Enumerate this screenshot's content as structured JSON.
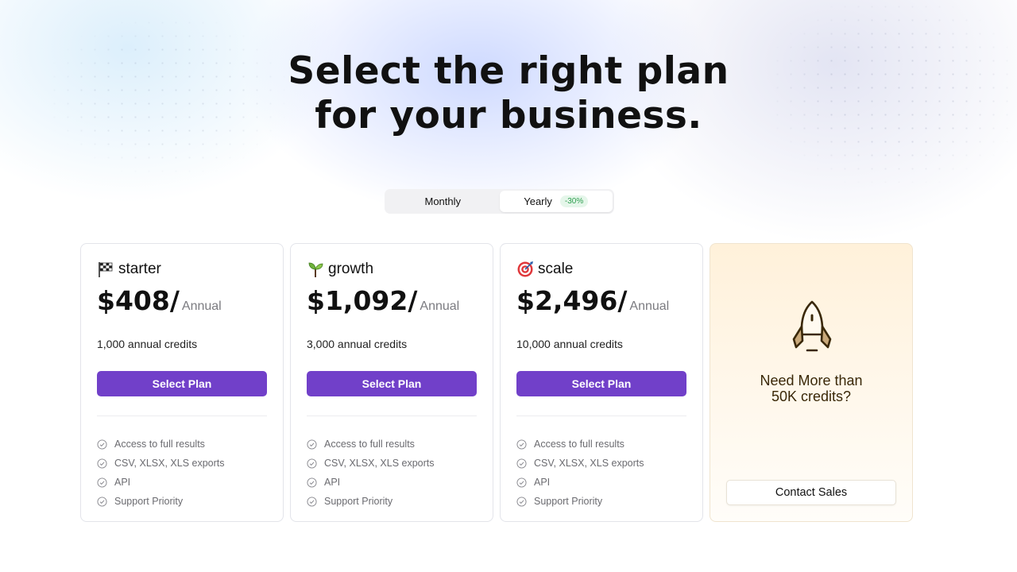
{
  "headline": {
    "line1": "Select the right plan",
    "line2": "for your business."
  },
  "billing_toggle": {
    "monthly_label": "Monthly",
    "yearly_label": "Yearly",
    "yearly_discount": "-30%",
    "selected": "Yearly"
  },
  "plans": [
    {
      "icon": "checkered-flag-icon",
      "name": "starter",
      "price": "$408/",
      "period": "Annual",
      "credits": "1,000 annual credits",
      "button_label": "Select Plan",
      "features": [
        "Access to full results",
        "CSV, XLSX, XLS exports",
        "API",
        "Support Priority"
      ]
    },
    {
      "icon": "seedling-icon",
      "name": "growth",
      "price": "$1,092/",
      "period": "Annual",
      "credits": "3,000 annual credits",
      "button_label": "Select Plan",
      "features": [
        "Access to full results",
        "CSV, XLSX, XLS exports",
        "API",
        "Support Priority"
      ]
    },
    {
      "icon": "target-icon",
      "name": "scale",
      "price": "$2,496/",
      "period": "Annual",
      "credits": "10,000 annual credits",
      "button_label": "Select Plan",
      "features": [
        "Access to full results",
        "CSV, XLSX, XLS exports",
        "API",
        "Support Priority"
      ]
    }
  ],
  "enterprise": {
    "icon": "rocket-icon",
    "line1": "Need More than",
    "line2": "50K credits?",
    "button_label": "Contact Sales"
  },
  "colors": {
    "accent": "#7140c9",
    "discount": "#2e9e4f",
    "enterprise_bg": "#fff1da"
  }
}
